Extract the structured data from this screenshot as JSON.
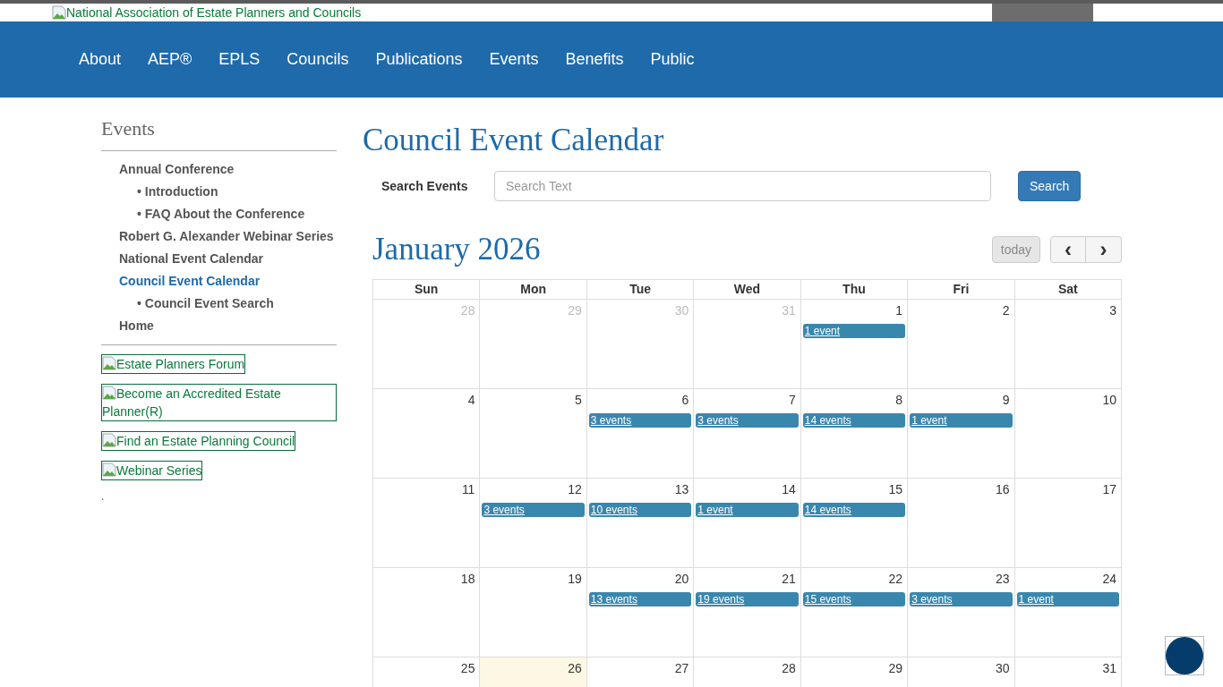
{
  "header": {
    "logo_alt": "National Association of Estate Planners and Councils"
  },
  "nav": [
    "About",
    "AEP®",
    "EPLS",
    "Councils",
    "Publications",
    "Events",
    "Benefits",
    "Public"
  ],
  "sidebar": {
    "title": "Events",
    "items": [
      {
        "label": "Annual Conference",
        "selected": false,
        "children": [
          {
            "label": "• Introduction",
            "selected": false
          },
          {
            "label": "• FAQ About the Conference",
            "selected": false
          }
        ]
      },
      {
        "label": "Robert G. Alexander Webinar Series",
        "selected": false
      },
      {
        "label": "National Event Calendar",
        "selected": false
      },
      {
        "label": "Council Event Calendar",
        "selected": true,
        "children": [
          {
            "label": "• Council Event Search",
            "selected": false
          }
        ]
      },
      {
        "label": "Home",
        "selected": false
      }
    ],
    "banners": [
      "Estate Planners Forum",
      "Become an Accredited Estate Planner(R)",
      "Find an Estate Planning Council",
      "Webinar Series"
    ],
    "dot": "."
  },
  "page_title": "Council Event Calendar",
  "search": {
    "label": "Search Events",
    "placeholder": "Search Text",
    "button": "Search"
  },
  "calendar": {
    "title": "January 2026",
    "today_button": "today",
    "today_disabled": true,
    "prev": "‹",
    "next": "›",
    "weekdays": [
      "Sun",
      "Mon",
      "Tue",
      "Wed",
      "Thu",
      "Fri",
      "Sat"
    ],
    "weeks": [
      [
        {
          "day": "28",
          "other": true,
          "today": false
        },
        {
          "day": "29",
          "other": true,
          "today": false
        },
        {
          "day": "30",
          "other": true,
          "today": false
        },
        {
          "day": "31",
          "other": true,
          "today": false
        },
        {
          "day": "1",
          "other": false,
          "today": false,
          "event": "1 event"
        },
        {
          "day": "2",
          "other": false,
          "today": false
        },
        {
          "day": "3",
          "other": false,
          "today": false
        }
      ],
      [
        {
          "day": "4",
          "other": false,
          "today": false
        },
        {
          "day": "5",
          "other": false,
          "today": false
        },
        {
          "day": "6",
          "other": false,
          "today": false,
          "event": "3 events"
        },
        {
          "day": "7",
          "other": false,
          "today": false,
          "event": "3 events"
        },
        {
          "day": "8",
          "other": false,
          "today": false,
          "event": "14 events"
        },
        {
          "day": "9",
          "other": false,
          "today": false,
          "event": "1 event"
        },
        {
          "day": "10",
          "other": false,
          "today": false
        }
      ],
      [
        {
          "day": "11",
          "other": false,
          "today": false
        },
        {
          "day": "12",
          "other": false,
          "today": false,
          "event": "3 events"
        },
        {
          "day": "13",
          "other": false,
          "today": false,
          "event": "10 events"
        },
        {
          "day": "14",
          "other": false,
          "today": false,
          "event": "1 event"
        },
        {
          "day": "15",
          "other": false,
          "today": false,
          "event": "14 events"
        },
        {
          "day": "16",
          "other": false,
          "today": false
        },
        {
          "day": "17",
          "other": false,
          "today": false
        }
      ],
      [
        {
          "day": "18",
          "other": false,
          "today": false
        },
        {
          "day": "19",
          "other": false,
          "today": false
        },
        {
          "day": "20",
          "other": false,
          "today": false,
          "event": "13 events"
        },
        {
          "day": "21",
          "other": false,
          "today": false,
          "event": "19 events"
        },
        {
          "day": "22",
          "other": false,
          "today": false,
          "event": "15 events"
        },
        {
          "day": "23",
          "other": false,
          "today": false,
          "event": "3 events"
        },
        {
          "day": "24",
          "other": false,
          "today": false,
          "event": "1 event"
        }
      ],
      [
        {
          "day": "25",
          "other": false,
          "today": false
        },
        {
          "day": "26",
          "other": false,
          "today": true
        },
        {
          "day": "27",
          "other": false,
          "today": false
        },
        {
          "day": "28",
          "other": false,
          "today": false
        },
        {
          "day": "29",
          "other": false,
          "today": false
        },
        {
          "day": "30",
          "other": false,
          "today": false
        },
        {
          "day": "31",
          "other": false,
          "today": false
        }
      ]
    ]
  }
}
